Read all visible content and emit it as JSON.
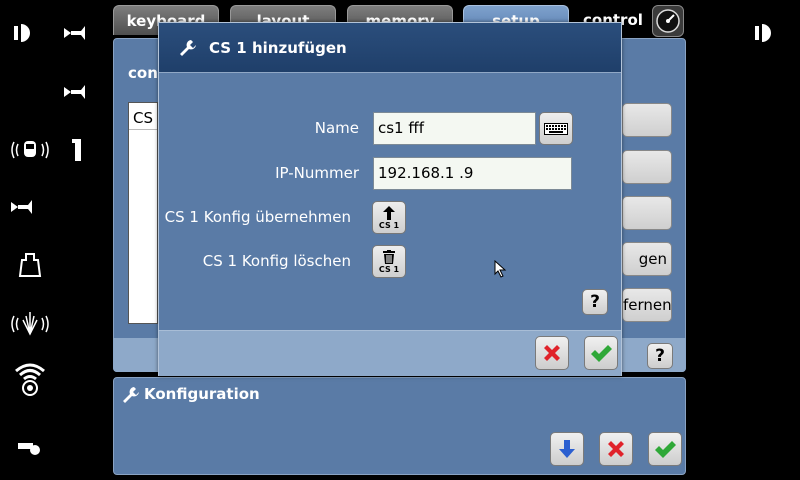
{
  "tabs": [
    {
      "label": "keyboard"
    },
    {
      "label": "layout"
    },
    {
      "label": "memory"
    },
    {
      "label": "setup"
    }
  ],
  "control_label": "control",
  "setup_panel": {
    "title": "con",
    "list_row": "CS",
    "buttons": [
      "",
      "",
      "",
      "gen",
      "fernen"
    ]
  },
  "dialog": {
    "title": "CS 1 hinzufügen",
    "name_label": "Name",
    "name_value": "cs1 fff",
    "ip_label": "IP-Nummer",
    "ip_value": "192.168.1  .9",
    "take_label": "CS 1 Konfig übernehmen",
    "take_badge": "CS 1",
    "delete_label": "CS 1 Konfig löschen",
    "delete_badge": "CS 1",
    "help": "?"
  },
  "footer_help": "?",
  "konfiguration": {
    "title": "Konfiguration"
  },
  "colors": {
    "panel": "#5a7ba6",
    "header": "#1f3f6a",
    "cancel_red": "#e0222a",
    "ok_green": "#2fa838",
    "down_blue": "#2b5fd0"
  },
  "icons": {
    "left": [
      "function-light-icon",
      "horn-icon",
      "horn-icon",
      "sound-radio-icon",
      "coupling-icon",
      "horn-icon",
      "weight-icon",
      "steam-sound-icon",
      "wifi-sound-icon",
      "whistle-icon"
    ],
    "right": [
      "function-light-icon"
    ]
  }
}
